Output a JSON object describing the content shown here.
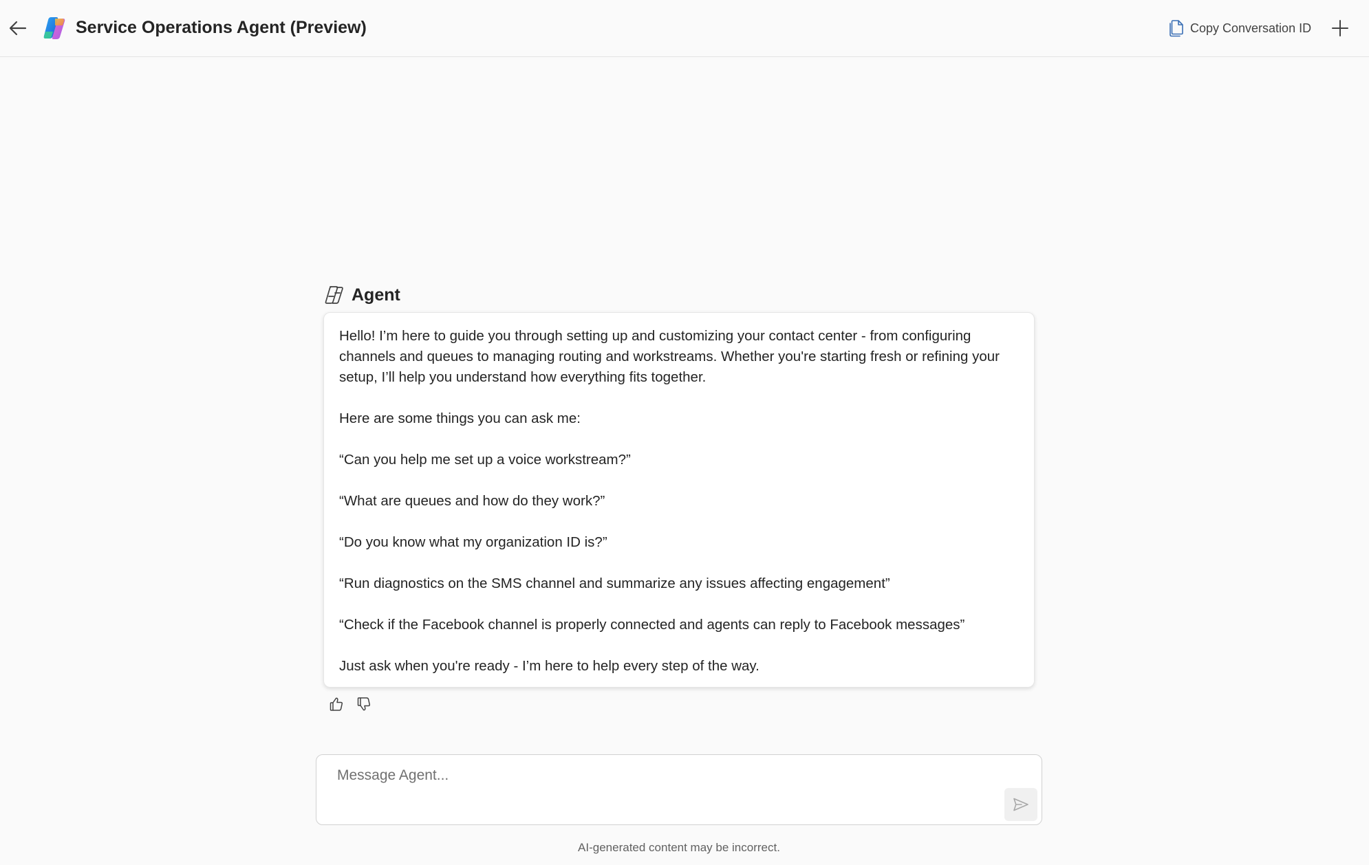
{
  "header": {
    "title": "Service Operations Agent (Preview)",
    "copy_label": "Copy Conversation ID",
    "back_icon": "arrow-left-icon",
    "logo_icon": "copilot-logo-icon",
    "copy_icon": "copy-icon",
    "new_icon": "plus-icon"
  },
  "agent": {
    "name": "Agent",
    "icon": "agent-icon"
  },
  "message": {
    "paragraphs": [
      "Hello! I’m here to guide you through setting up and customizing your contact center - from configuring channels and queues to managing routing and workstreams. Whether you're starting fresh or refining your setup, I’ll help you understand how everything fits together.",
      "Here are some things you can ask me:",
      "“Can you help me set up a voice workstream?”",
      "“What are queues and how do they work?”",
      "“Do you know what my organization ID is?”",
      "“Run diagnostics on the SMS channel and summarize any issues affecting engagement”",
      "“Check if the Facebook channel is properly connected and agents can reply to Facebook messages”",
      "Just ask when you're ready - I’m here to help every step of the way."
    ]
  },
  "feedback": {
    "like_icon": "thumbs-up-icon",
    "dislike_icon": "thumbs-down-icon"
  },
  "composer": {
    "placeholder": "Message Agent...",
    "value": "",
    "send_icon": "send-icon"
  },
  "footer": {
    "disclaimer": "AI-generated content may be incorrect."
  },
  "colors": {
    "background": "#fafafa",
    "card": "#ffffff",
    "text": "#242424",
    "accent": "#0f6cbd"
  }
}
